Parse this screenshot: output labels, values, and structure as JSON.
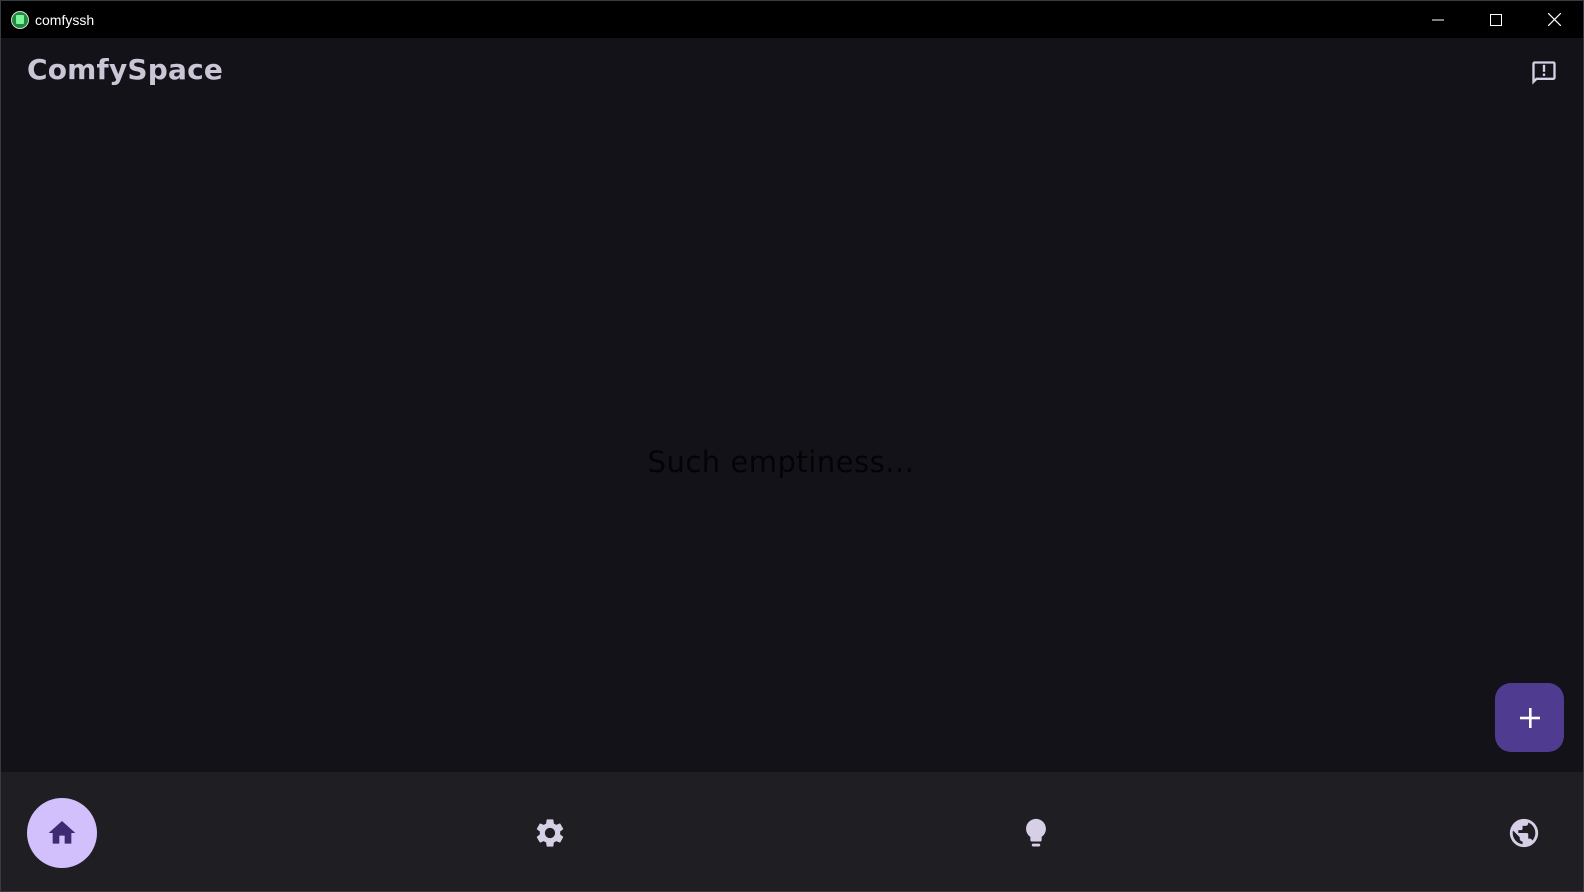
{
  "window": {
    "title": "comfyssh",
    "controls": [
      {
        "name": "minimize-button",
        "icon": "minimize-icon"
      },
      {
        "name": "maximize-button",
        "icon": "maximize-icon"
      },
      {
        "name": "close-button",
        "icon": "close-icon"
      }
    ]
  },
  "header": {
    "title": "ComfySpace",
    "feedback_icon": "feedback-icon"
  },
  "main": {
    "empty_message": "Such emptiness..."
  },
  "fab": {
    "icon": "plus-icon"
  },
  "bottom_nav": {
    "items": [
      {
        "id": "home",
        "icon": "home-icon",
        "active": true
      },
      {
        "id": "settings",
        "icon": "gear-icon",
        "active": false
      },
      {
        "id": "tips",
        "icon": "lightbulb-icon",
        "active": false
      },
      {
        "id": "web",
        "icon": "globe-icon",
        "active": false
      }
    ]
  },
  "colors": {
    "background": "#131219",
    "nav_background": "#1e1e23",
    "accent": "#4f3b8f",
    "active_nav": "#d1c0fb",
    "title_text": "#cbc6d6",
    "icon": "#d6cfe6"
  }
}
